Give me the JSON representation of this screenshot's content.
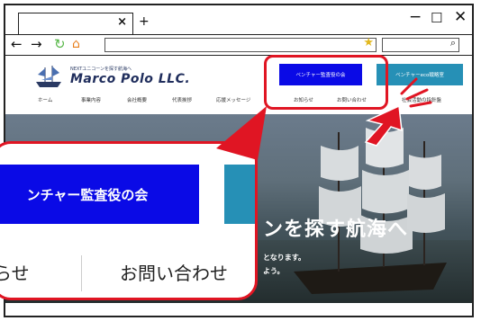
{
  "browser": {
    "tab_close": "×",
    "new_tab": "+",
    "window_controls": {
      "minimize": "−",
      "maximize": "☐",
      "close": "✕"
    },
    "nav": {
      "back": "←",
      "forward": "→",
      "reload": "↻",
      "home": "⌂"
    },
    "url": "",
    "search_placeholder": "",
    "star_icon": "★",
    "search_icon": "⌕"
  },
  "site": {
    "logo_tagline": "NEXTユニコーンを探す航海へ",
    "logo_name": "Marco Polo LLC.",
    "header_buttons": [
      {
        "label": "ベンチャー監査役の会",
        "color": "#0a0ae6"
      },
      {
        "label": "ベンチャーeco戦略室",
        "color": "#2690b6"
      }
    ],
    "nav_items": [
      "ホーム",
      "事業内容",
      "会社概要",
      "代表挨拶",
      "応援メッセージ",
      "お知らせ",
      "お問い合わせ",
      "社会活動の指針盤"
    ],
    "hero": {
      "title": "ンを探す航海へ",
      "sub1": "となります。",
      "sub2": "よう。"
    }
  },
  "zoom": {
    "button_primary": "ンチャー監査役の会",
    "nav_item_1": "らせ",
    "nav_item_2": "お問い合わせ"
  },
  "colors": {
    "highlight": "#e01523",
    "primary_button": "#0a0ae6",
    "secondary_button": "#2690b6"
  }
}
